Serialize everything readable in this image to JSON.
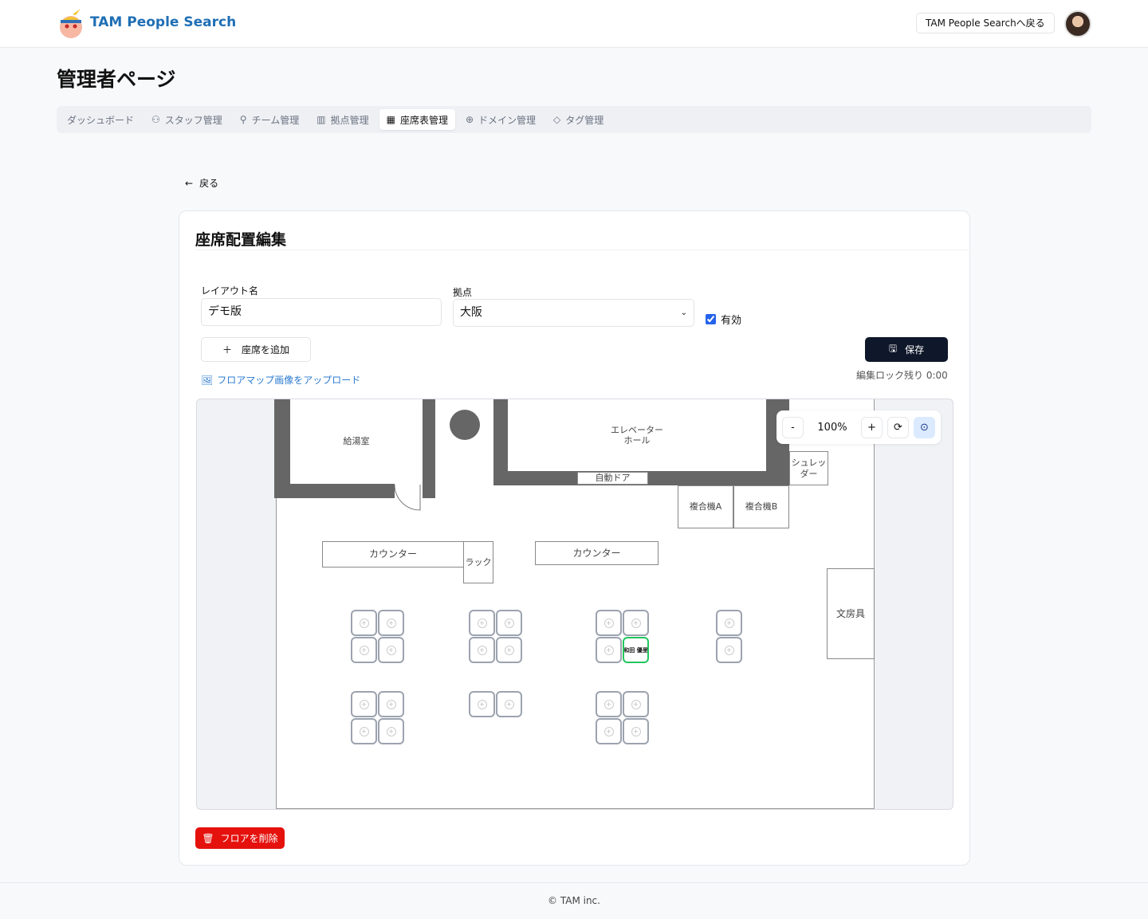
{
  "header": {
    "brand": "TAM People Search",
    "back_to_site": "TAM People Searchへ戻る"
  },
  "page_title": "管理者ページ",
  "tabs": [
    {
      "label": "ダッシュボード",
      "icon": "none"
    },
    {
      "label": "スタッフ管理",
      "icon": "users-icon"
    },
    {
      "label": "チーム管理",
      "icon": "team-icon"
    },
    {
      "label": "拠点管理",
      "icon": "building-icon"
    },
    {
      "label": "座席表管理",
      "icon": "grid-icon",
      "active": true
    },
    {
      "label": "ドメイン管理",
      "icon": "globe-icon"
    },
    {
      "label": "タグ管理",
      "icon": "tag-icon"
    }
  ],
  "back_label": "戻る",
  "card": {
    "title": "座席配置編集",
    "layout_name_label": "レイアウト名",
    "layout_name_value": "デモ版",
    "location_label": "拠点",
    "location_value": "大阪",
    "active_label": "有効",
    "active_checked": true,
    "add_seat": "座席を追加",
    "save": "保存",
    "lock_remaining": "編集ロック残り 0:00",
    "upload": "フロアマップ画像をアップロード",
    "delete": "フロアを削除"
  },
  "map": {
    "zoom": "100%",
    "zoom_out": "-",
    "zoom_in": "+",
    "rooms": {
      "kitchen": "給湯室",
      "elevator": "エレベーター\nホール",
      "auto_door": "自動ドア",
      "shredder": "シュレッ\nダー",
      "mfp_a": "複合機A",
      "mfp_b": "複合機B",
      "counter1": "カウンター",
      "rack": "ラック",
      "counter2": "カウンター",
      "stationery": "文房具"
    },
    "seats": [
      "",
      "",
      "",
      "",
      "",
      "",
      "",
      "",
      "",
      "",
      "",
      "和田 優里",
      "",
      "",
      "",
      "",
      "",
      " ",
      "",
      "",
      "",
      "",
      "",
      "",
      "",
      "",
      "",
      "",
      "",
      ""
    ]
  },
  "colors": {
    "brand": "#1f6fb5",
    "save": "#0f172a",
    "delete": "#e5110d",
    "occupied_seat": "#22c55e"
  },
  "footer": "© TAM inc."
}
